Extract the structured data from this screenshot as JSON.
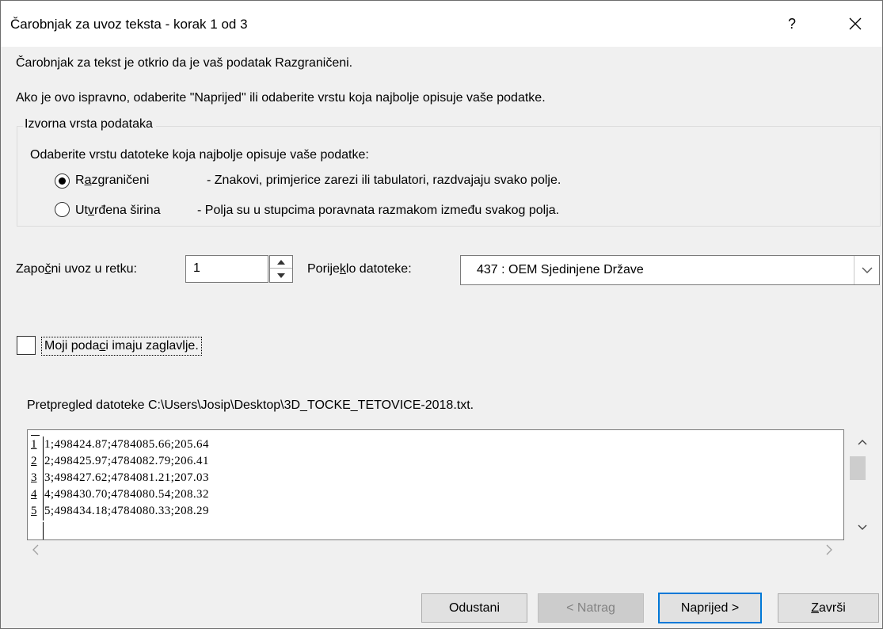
{
  "window": {
    "title": "Čarobnjak za uvoz teksta - korak 1 od 3",
    "help_label": "?"
  },
  "intro": {
    "line1": "Čarobnjak za tekst je otkrio da je vaš podatak Razgraničeni.",
    "line2": "Ako je ovo ispravno, odaberite \"Naprijed\" ili odaberite vrstu koja najbolje opisuje vaše podatke."
  },
  "source_type": {
    "group_label": "Izvorna vrsta podataka",
    "prompt": "Odaberite vrstu datoteke koja najbolje opisuje vaše podatke:",
    "options": [
      {
        "pre": "R",
        "key": "a",
        "post": "zgraničeni",
        "description": "- Znakovi, primjerice zarezi ili tabulatori, razdvajaju svako polje.",
        "selected": true
      },
      {
        "pre": "Ut",
        "key": "v",
        "post": "rđena širina",
        "description": "- Polja su u stupcima poravnata razmakom između svakog polja.",
        "selected": false
      }
    ]
  },
  "start_row": {
    "label_pre": "Zapo",
    "label_key": "č",
    "label_post": "ni uvoz u retku:",
    "value": "1"
  },
  "file_origin": {
    "label_pre": "Porije",
    "label_key": "k",
    "label_post": "lo datoteke:",
    "value": "437 : OEM Sjedinjene Države"
  },
  "header_checkbox": {
    "label_pre": "Moji poda",
    "label_key": "c",
    "label_post": "i imaju zaglavlje.",
    "checked": false
  },
  "preview": {
    "label": "Pretpregled datoteke C:\\Users\\Josip\\Desktop\\3D_TOCKE_TETOVICE-2018.txt.",
    "rows": [
      {
        "num": "1",
        "text": "1;498424.87;4784085.66;205.64"
      },
      {
        "num": "2",
        "text": "2;498425.97;4784082.79;206.41"
      },
      {
        "num": "3",
        "text": "3;498427.62;4784081.21;207.03"
      },
      {
        "num": "4",
        "text": "4;498430.70;4784080.54;208.32"
      },
      {
        "num": "5",
        "text": "5;498434.18;4784080.33;208.29"
      }
    ]
  },
  "buttons": {
    "cancel": "Odustani",
    "back": "< Natrag",
    "next": "Naprijed >",
    "finish_key": "Z",
    "finish_post": "avrši"
  }
}
